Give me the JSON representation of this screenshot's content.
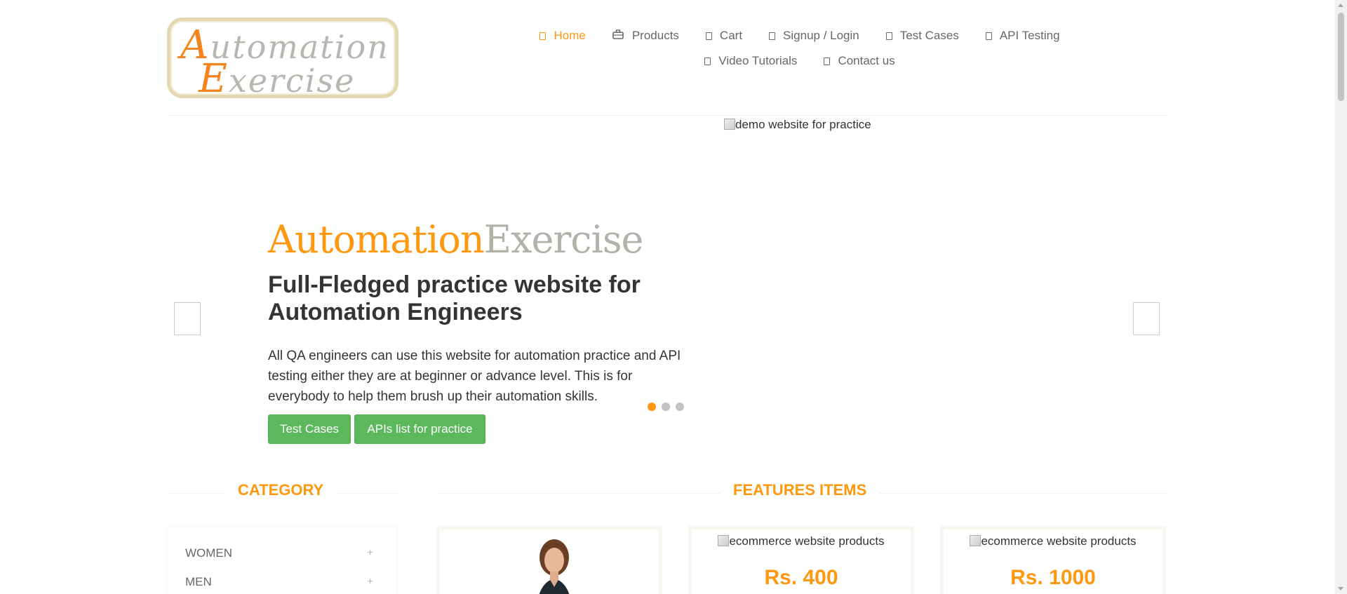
{
  "header": {
    "logo": {
      "line1_cap": "A",
      "line1_rest": "utomation",
      "line2_cap": "E",
      "line2_rest": "xercise"
    },
    "nav": [
      {
        "label": "Home",
        "icon": "home-icon",
        "active": true
      },
      {
        "label": "Products",
        "icon": "briefcase-icon"
      },
      {
        "label": "Cart",
        "icon": "cart-icon"
      },
      {
        "label": "Signup / Login",
        "icon": "lock-icon"
      },
      {
        "label": "Test Cases",
        "icon": "list-icon"
      },
      {
        "label": "API Testing",
        "icon": "list-icon"
      },
      {
        "label": "Video Tutorials",
        "icon": "youtube-icon"
      },
      {
        "label": "Contact us",
        "icon": "envelope-icon"
      }
    ]
  },
  "slider": {
    "image_alt": "demo website for practice",
    "brand_part1": "Automation",
    "brand_part2": "Exercise",
    "headline": "Full-Fledged practice website for Automation Engineers",
    "description": "All QA engineers can use this website for automation practice and API testing either they are at beginner or advance level. This is for everybody to help them brush up their automation skills.",
    "buttons": {
      "test_cases": "Test Cases",
      "apis": "APIs list for practice"
    },
    "active_slide": 1,
    "slide_count": 3
  },
  "category": {
    "title": "Category",
    "items": [
      "Women",
      "Men"
    ]
  },
  "features": {
    "title": "Features Items",
    "products": [
      {
        "image_alt": "",
        "price": ""
      },
      {
        "image_alt": "ecommerce website products",
        "price": "Rs. 400"
      },
      {
        "image_alt": "ecommerce website products",
        "price": "Rs. 1000"
      }
    ]
  },
  "colors": {
    "accent": "#fe980f",
    "button": "#5cb85c",
    "text": "#696763",
    "dark_text": "#363432"
  }
}
